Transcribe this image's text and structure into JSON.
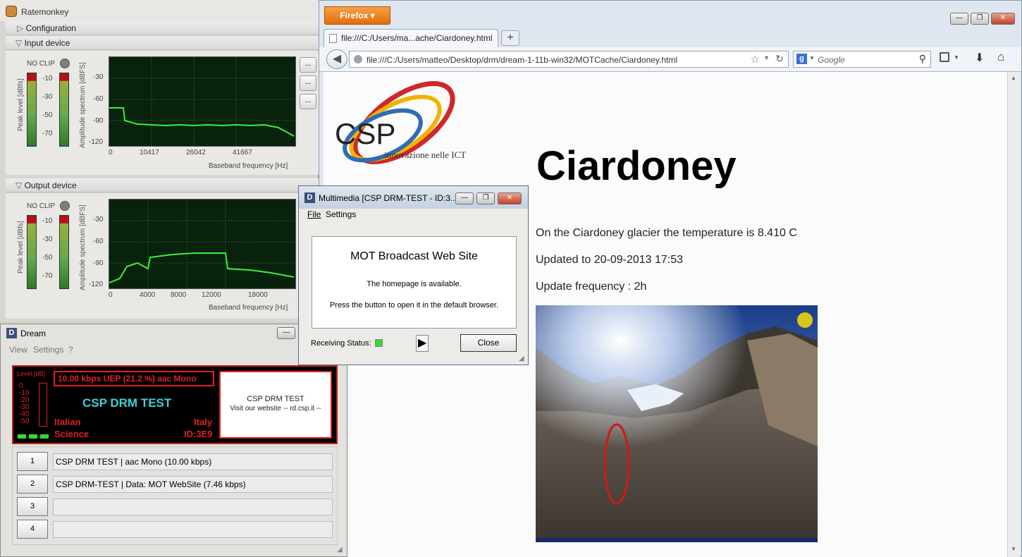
{
  "firefox": {
    "menu_button": "Firefox",
    "tab_title": "file:///C:/Users/ma...ache/Ciardoney.html",
    "new_tab": "+",
    "url": "file:///C:/Users/matteo/Desktop/drm/dream-1-11b-win32/MOTCache/Ciardoney.html",
    "search_placeholder": "Google",
    "page": {
      "logo_text": "CSP",
      "logo_tagline": "innovazione nelle ICT",
      "heading": "Ciardoney",
      "line1": "On the Ciardoney glacier the temperature is 8.410 C",
      "line2": "Updated to 20-09-2013 17:53",
      "line3": "Update frequency : 2h"
    }
  },
  "ratemonkey": {
    "title": "Ratemonkey",
    "configuration": "Configuration",
    "input_device": "Input device",
    "output_device": "Output device",
    "no_clip": "NO CLIP",
    "peak_label": "Peak level [dBfs]",
    "amp_label": "Amplitude spectrum [dBFS]",
    "freq_label": "Baseband frequency [Hz]",
    "peak_ticks": [
      "-10",
      "-30",
      "-50",
      "-70"
    ],
    "amp_ticks": [
      "-30",
      "-60",
      "-90",
      "-120"
    ],
    "input_x_ticks": [
      "0",
      "10417",
      "26042",
      "41667"
    ],
    "output_x_ticks": [
      "0",
      "4000",
      "8000",
      "12000",
      "18000"
    ],
    "side_btn": "..."
  },
  "dream": {
    "title": "Dream",
    "menu": [
      "View",
      "Settings",
      "?"
    ],
    "level_label": "Level [dB]",
    "level_ticks": [
      "0",
      "-10",
      "-20",
      "-30",
      "-40",
      "-50"
    ],
    "bitrate": "10.00 kbps UEP (21.2 %)  aac Mono",
    "station": "CSP DRM TEST",
    "language": "Italian",
    "country": "Italy",
    "genre": "Science",
    "id": "ID:3E9",
    "text_msg_1": "CSP DRM TEST",
    "text_msg_2": "Visit our website -- rd.csp.it --",
    "services": [
      {
        "num": "1",
        "label": "CSP DRM TEST  |  aac Mono (10.00 kbps)"
      },
      {
        "num": "2",
        "label": "CSP DRM-TEST  |  Data: MOT WebSite (7.46 kbps)"
      },
      {
        "num": "3",
        "label": ""
      },
      {
        "num": "4",
        "label": ""
      }
    ]
  },
  "multimedia": {
    "title": "Multimedia [CSP DRM-TEST - ID:3...",
    "menu_file": "File",
    "menu_settings": "Settings",
    "heading": "MOT Broadcast Web Site",
    "msg1": "The homepage is available.",
    "msg2": "Press the button to open it in the default browser.",
    "status_label": "Receiving Status:",
    "close": "Close"
  },
  "colors": {
    "accent_green": "#2fdc2f",
    "dream_red": "#e02020",
    "cyan": "#3fd0d8",
    "firefox_orange": "#e8780f"
  }
}
